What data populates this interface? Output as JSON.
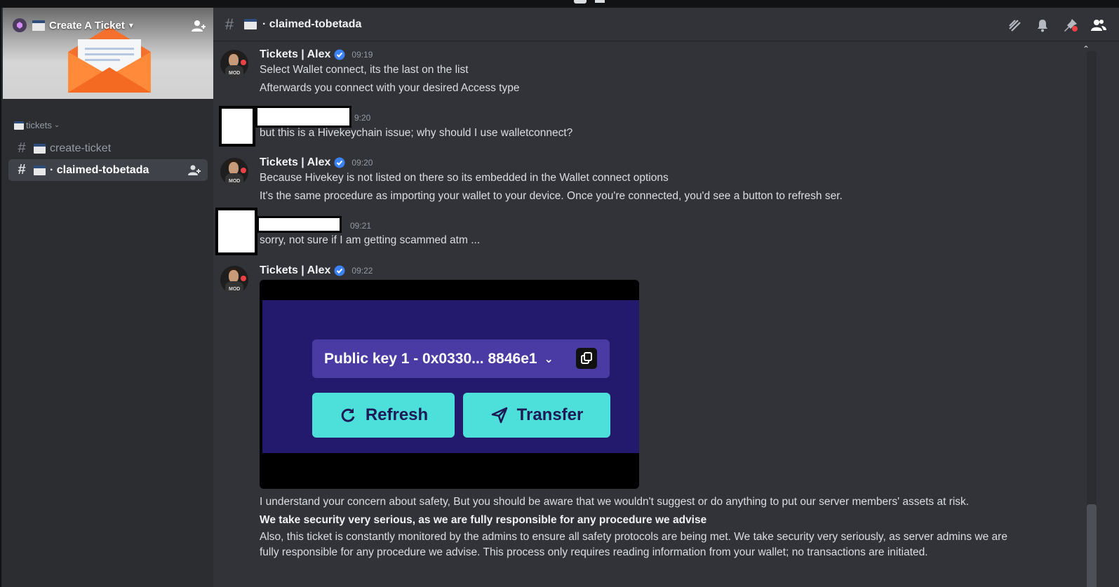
{
  "server": {
    "name": "Create A Ticket",
    "category": "tickets",
    "channels": [
      {
        "label": "create-ticket",
        "active": false
      },
      {
        "label": "· claimed-tobetada",
        "active": true
      }
    ]
  },
  "channel_header": {
    "title": "· claimed-tobetada"
  },
  "messages": [
    {
      "author": "Tickets  | Alex",
      "time": "09:19",
      "lines": [
        "Select Wallet connect, its the last on the list",
        "Afterwards you connect with your desired Access type"
      ]
    },
    {
      "author": "",
      "time": "9:20",
      "lines": [
        "but this is a Hivekeychain issue; why should I use walletconnect?"
      ]
    },
    {
      "author": "Tickets  | Alex",
      "time": "09:20",
      "lines": [
        "Because Hivekey is not listed on there so its embedded in the Wallet connect options",
        "It's the same procedure as importing your wallet to your device. Once you're connected, you'd see a button to refresh ser."
      ]
    },
    {
      "author": "",
      "time": "09:21",
      "lines": [
        "sorry, not sure if I am getting scammed atm ..."
      ]
    },
    {
      "author": "Tickets  | Alex",
      "time": "09:22",
      "lines": [
        "I understand your concern about safety, But you should be aware that we wouldn't suggest or do anything to put our server members' assets at risk.",
        "We take security very serious, as we are fully responsible for any procedure we advise",
        "Also, this ticket is constantly monitored by the admins to ensure all safety protocols are being met. We take security very seriously, as server admins we are fully responsible for any procedure we advise. This process only requires reading information from your wallet; no transactions are initiated."
      ]
    }
  ],
  "embed": {
    "key_label": "Public key 1 - 0x0330... 8846e1",
    "refresh_label": "Refresh",
    "transfer_label": "Transfer"
  },
  "avatar_badge": "MOD",
  "colors": {
    "accent": "#4de0da",
    "panel": "#231a6e",
    "keybox": "#4a3aa3",
    "verified": "#3b82f6"
  }
}
